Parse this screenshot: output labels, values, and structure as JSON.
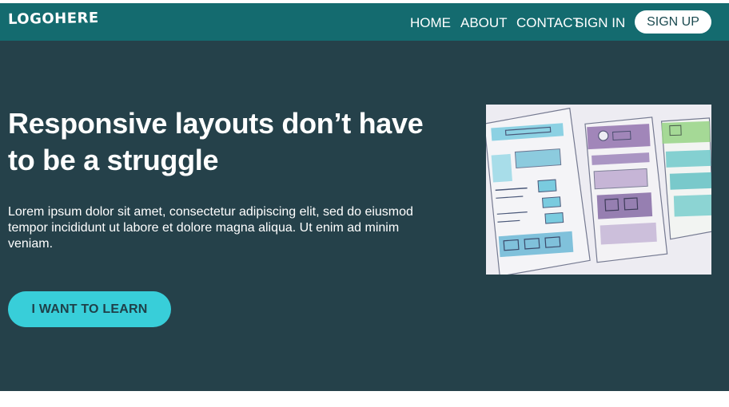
{
  "header": {
    "logo": "LOGOHERE",
    "nav": [
      {
        "label": "HOME"
      },
      {
        "label": "ABOUT"
      },
      {
        "label": "CONTACT"
      },
      {
        "label": "SIGN IN"
      }
    ],
    "signup_label": "SIGN UP"
  },
  "hero": {
    "title": "Responsive layouts don’t have to be a struggle",
    "text": "Lorem ipsum dolor sit amet, consectetur adipiscing elit, sed do eiusmod tempor incididunt ut labore et dolore magna aliqua. Ut enim ad minim veniam.",
    "cta_label": "I WANT TO LEARN"
  },
  "colors": {
    "navbar": "#146b6f",
    "hero_background": "#25414a",
    "cta": "#38ced9"
  }
}
